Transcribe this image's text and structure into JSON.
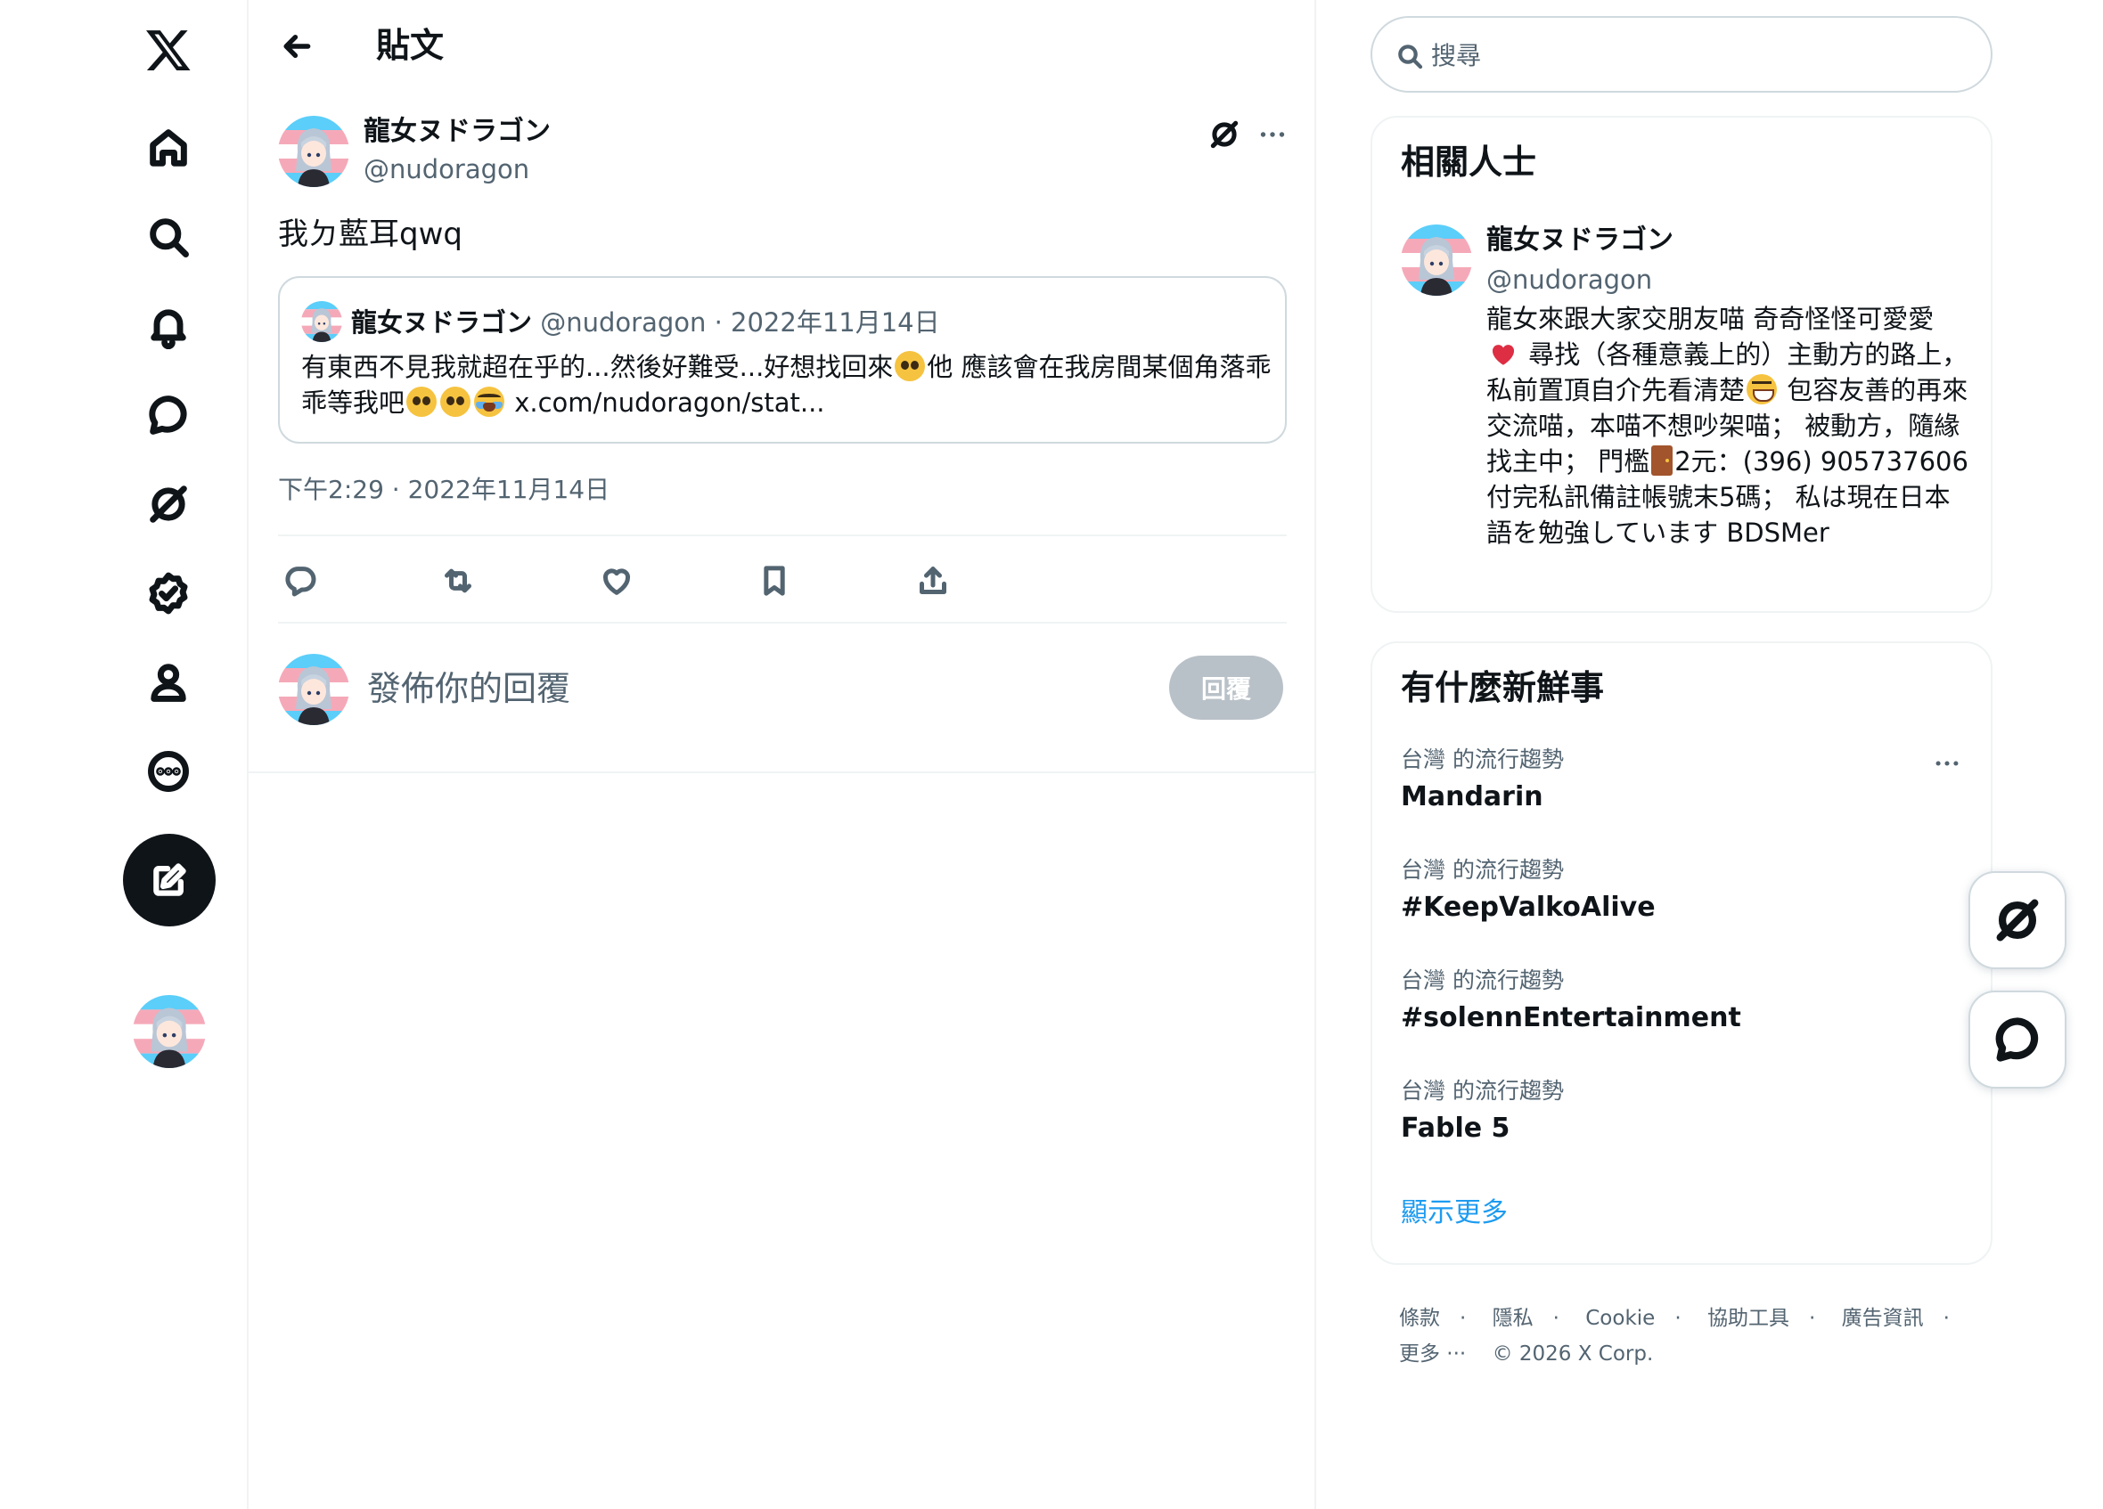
{
  "nav": {
    "items": [
      "x-logo",
      "home-icon",
      "search-icon",
      "bell-icon",
      "chat-icon",
      "grok-icon",
      "verified-icon",
      "profile-icon",
      "more-circle-icon"
    ],
    "compose_icon": "compose-icon"
  },
  "header": {
    "title": "貼文"
  },
  "post": {
    "author_name": "龍女ヌドラゴン",
    "author_handle": "@nudoragon",
    "text": "我ㄉ藍耳qwq",
    "quote": {
      "author_name": "龍女ヌドラゴン",
      "meta": "@nudoragon · 2022年11月14日",
      "text_part1": "有東西不見我就超在乎的...然後好難受...好想找回來",
      "text_part2": "他 應該會在我房間某個角落乖乖等我吧",
      "link": "x.com/nudoragon/stat..."
    },
    "timestamp": "下午2:29 · 2022年11月14日",
    "actions": [
      "reply-icon",
      "retweet-icon",
      "like-icon",
      "bookmark-icon",
      "share-icon"
    ]
  },
  "reply": {
    "placeholder": "發佈你的回覆",
    "button_label": "回覆"
  },
  "search": {
    "placeholder": "搜尋"
  },
  "related": {
    "title": "相關人士",
    "name": "龍女ヌドラゴン",
    "handle": "@nudoragon",
    "bio_1": "龍女來跟大家交朋友喵 奇奇怪怪可愛愛",
    "bio_2": "尋找（各種意義上的）主動方的路上， 私前置頂自介先看清楚",
    "bio_3": "包容友善的再來交流喵，本喵不想吵架喵； 被動方，隨緣找主中； 門檻",
    "bio_4": "2元：(396) 905737606 付完私訊備註帳號末5碼； 私は現在日本語を勉強しています BDSMer"
  },
  "trends": {
    "title": "有什麼新鮮事",
    "items": [
      {
        "meta": "台灣 的流行趨勢",
        "name": "Mandarin"
      },
      {
        "meta": "台灣 的流行趨勢",
        "name": "#KeepValkoAlive"
      },
      {
        "meta": "台灣 的流行趨勢",
        "name": "#solennEntertainment"
      },
      {
        "meta": "台灣 的流行趨勢",
        "name": "Fable 5"
      }
    ],
    "show_more": "顯示更多"
  },
  "footer": {
    "terms": "條款",
    "privacy": "隱私",
    "cookie": "Cookie",
    "accessibility": "協助工具",
    "ads": "廣告資訊",
    "more": "更多 ···",
    "copyright": "© 2026 X Corp."
  },
  "colors": {
    "accent": "#1d9bf0",
    "text": "#0f1419",
    "secondary": "#536471",
    "border": "#eff3f4"
  }
}
